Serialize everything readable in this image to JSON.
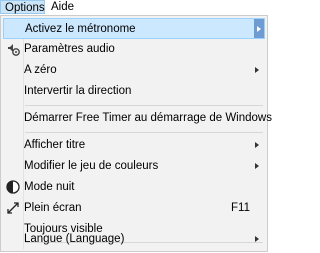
{
  "menubar": {
    "options": "Options",
    "aide": "Aide"
  },
  "menu": {
    "items": [
      {
        "label": "Activez le métronome",
        "submenu": true,
        "highlighted": true
      },
      {
        "label": "Paramètres audio",
        "icon": "audio-settings-icon"
      },
      {
        "label": "A zéro",
        "submenu": true
      },
      {
        "label": "Intervertir la direction"
      },
      {
        "label": "Démarrer Free Timer au démarrage de Windows"
      },
      {
        "label": "Afficher titre",
        "submenu": true
      },
      {
        "label": "Modifier le jeu de couleurs",
        "submenu": true
      },
      {
        "label": "Mode nuit",
        "icon": "night-mode-icon"
      },
      {
        "label": "Plein écran",
        "shortcut": "F11",
        "icon": "fullscreen-icon"
      },
      {
        "label": "Toujours visible"
      },
      {
        "label": "Langue (Language)",
        "submenu": true
      }
    ]
  }
}
